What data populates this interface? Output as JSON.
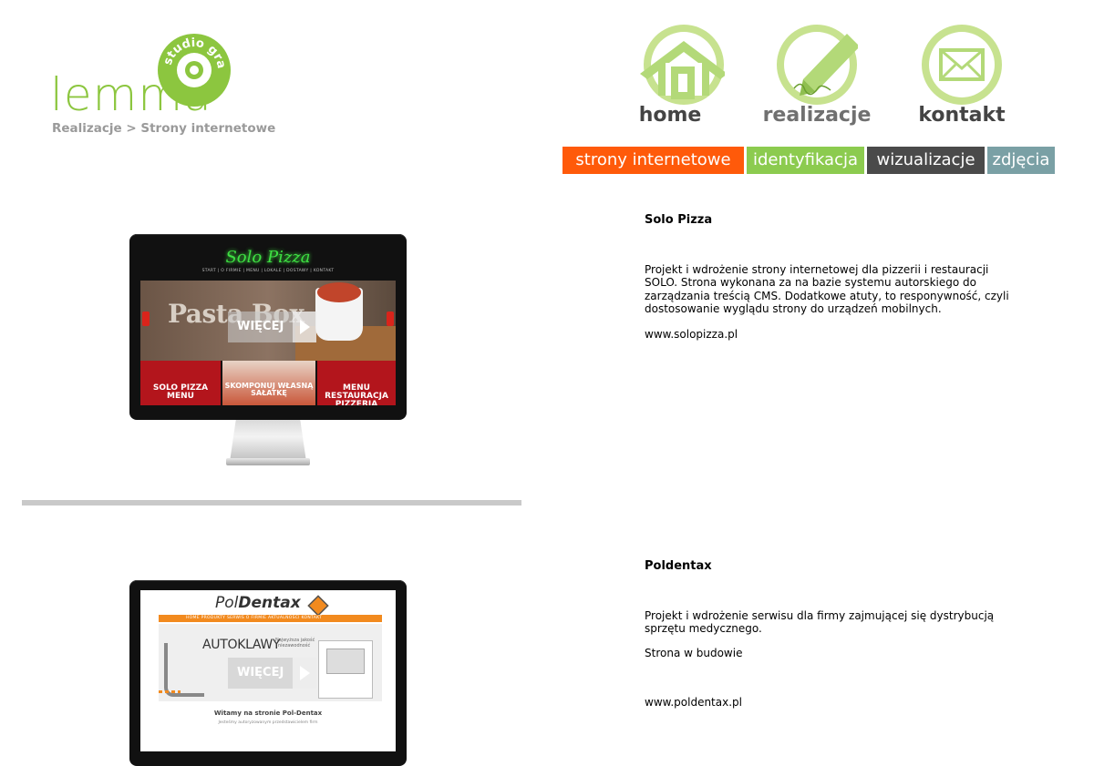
{
  "logo": {
    "word": "lemma",
    "circle_text": "studio graficzne",
    "color": "#8cc63f"
  },
  "breadcrumb": "Realizacje > Strony internetowe",
  "nav": [
    {
      "label": "home",
      "icon": "house-icon"
    },
    {
      "label": "realizacje",
      "icon": "pencil-icon"
    },
    {
      "label": "kontakt",
      "icon": "envelope-icon"
    }
  ],
  "categories": [
    {
      "label": "strony internetowe",
      "color": "#ff5a0a"
    },
    {
      "label": "identyfikacja",
      "color": "#8ccb4f"
    },
    {
      "label": "wizualizacje",
      "color": "#4a4a4a"
    },
    {
      "label": "zdjęcia",
      "color": "#7aa0a5"
    }
  ],
  "projects": [
    {
      "title": "Solo Pizza",
      "description": "Projekt i wdrożenie strony internetowej dla pizzerii i restauracji SOLO. Strona wykonana za na bazie systemu autorskiego do zarządzania treścią CMS. Dodatkowe atuty, to responywność, czyli dostosowanie wyglądu strony do urządzeń mobilnych.",
      "url": "www.solopizza.pl",
      "screen": {
        "logo": "Solo Pizza",
        "menu": "START | O FIRMIE | MENU | LOKALE | DOSTAWY | KONTAKT",
        "banner_text": "Pasta Box",
        "button": "WIĘCEJ",
        "tile1": "SOLO PIZZA MENU",
        "tile2": "SKOMPONUJ WŁASNĄ SAŁATKĘ",
        "tile3": "MENU RESTAURACJA PIZZERIA"
      }
    },
    {
      "title": "Poldentax",
      "description": "Projekt i wdrożenie serwisu dla firmy zajmującej się dystrybucją sprzętu medycznego.",
      "status": "Strona w budowie",
      "url": "www.poldentax.pl",
      "screen": {
        "logo_a": "Pol",
        "logo_b": "Dentax",
        "menu": "HOME    PRODUKTY    SERWIS    O FIRMIE    AKTUALNOŚCI    KONTAKT",
        "banner_title": "AUTOKLAWY",
        "banner_sub": "Najwyższa jakość i niezawodność",
        "button": "WIĘCEJ",
        "welcome": "Witamy na stronie Pol-Dentax",
        "welcome_sub": "Jesteśmy autoryzowanym przedstawicielem firm"
      }
    }
  ]
}
